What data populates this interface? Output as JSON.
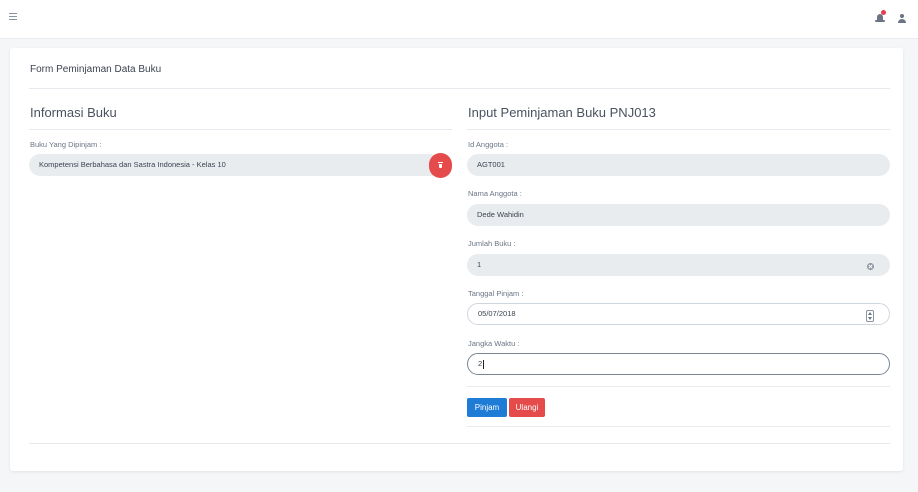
{
  "topbar": {
    "menu_icon": "hamburger-icon",
    "notification_icon": "bell-icon",
    "notification_badge_color": "#e53e4f",
    "user_icon": "user-icon"
  },
  "card": {
    "title": "Form Peminjaman Data Buku"
  },
  "left": {
    "section_title": "Informasi Buku",
    "book_label": "Buku Yang Dipinjam :",
    "book_value": "Kompetensi Berbahasa dan Sastra Indonesia - Kelas 10",
    "remove_icon": "trash-icon"
  },
  "right": {
    "section_title": "Input Peminjaman Buku PNJ013",
    "fields": {
      "id_anggota": {
        "label": "Id Anggota :",
        "value": "AGT001"
      },
      "nama_anggota": {
        "label": "Nama Anggota :",
        "value": "Dede Wahidin"
      },
      "jumlah_buku": {
        "label": "Jumlah Buku :",
        "value": "1"
      },
      "tanggal_pinjam": {
        "label": "Tanggal Pinjam :",
        "value": "05/07/2018"
      },
      "jangka_waktu": {
        "label": "Jangka Waktu :",
        "value": "2"
      }
    },
    "buttons": {
      "submit": "Pinjam",
      "reset": "Ulangi"
    }
  },
  "colors": {
    "primary": "#1e7bd6",
    "danger": "#e54b4b",
    "readonly_bg": "#e9ecef"
  }
}
